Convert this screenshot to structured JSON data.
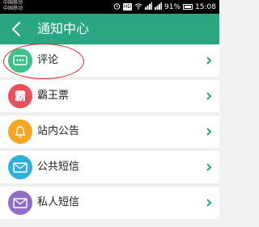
{
  "status_bar": {
    "carrier_1": "中国移动",
    "carrier_2": "中国移动",
    "battery": "91%",
    "time": "15:08"
  },
  "header": {
    "title": "通知中心"
  },
  "colors": {
    "header_bg": "#2aa682",
    "comment": "#3cc08c",
    "ticket": "#e8505b",
    "announce": "#f5a623",
    "public_sms": "#2fb0d8",
    "private_sms": "#8e6fc7",
    "chevron": "#2aa682"
  },
  "items": [
    {
      "label": "评论",
      "icon": "comment-dots-icon"
    },
    {
      "label": "霸王票",
      "icon_text": "霸",
      "icon": "ticket-badge-icon"
    },
    {
      "label": "站内公告",
      "icon": "bell-icon"
    },
    {
      "label": "公共短信",
      "icon": "envelope-icon"
    },
    {
      "label": "私人短信",
      "icon": "envelope-icon"
    }
  ]
}
